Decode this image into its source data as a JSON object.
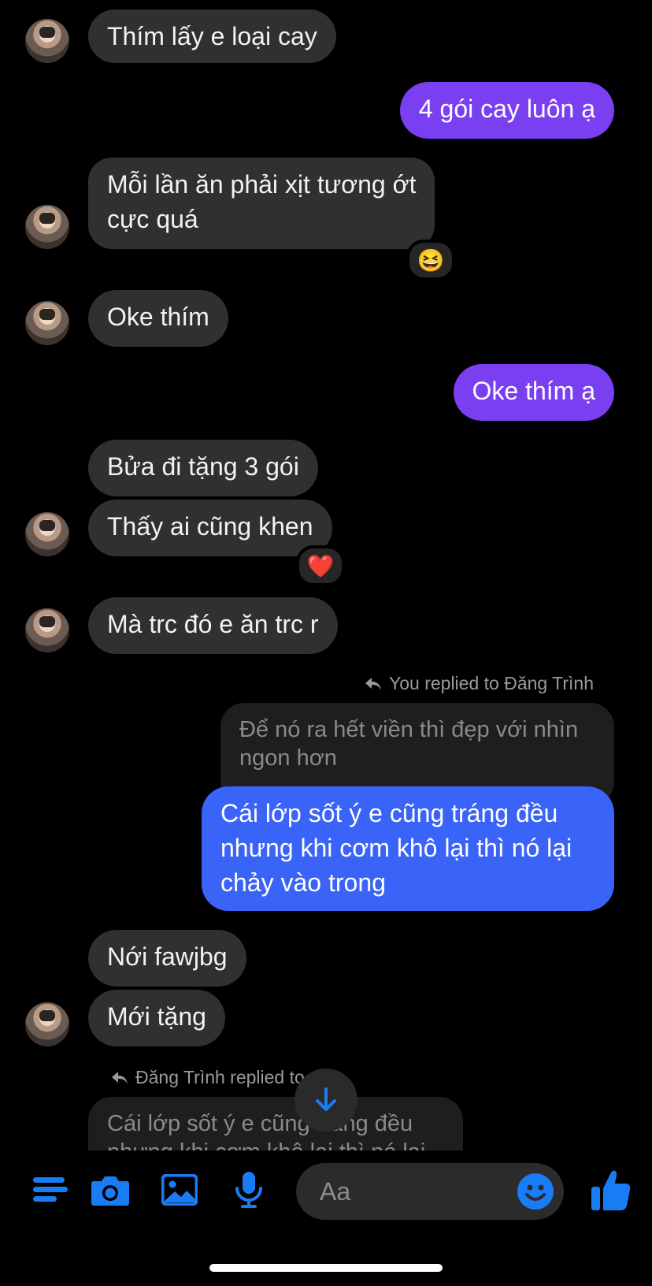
{
  "messages": {
    "m1": "Thím lấy e loại cay",
    "m2": "4 gói cay luôn ạ",
    "m3_l1": "Mỗi lần ăn phải xịt tương ớt",
    "m3_l2": "cực quá",
    "m3_reaction": "😆",
    "m4": "Oke thím",
    "m5": "Oke thím ạ",
    "m6": "Bửa đi tặng 3 gói",
    "m7": "Thấy ai cũng khen",
    "m7_reaction": "❤️",
    "m8": "Mà trc đó e ăn trc r",
    "reply1_note": "You replied to Đăng Trình",
    "reply1_quote_l1": "Để nó ra hết viền thì đẹp với nhìn",
    "reply1_quote_l2": "ngon hơn",
    "m9_l1": "Cái lớp sốt ý e cũng tráng đều",
    "m9_l2": "nhưng khi cơm khô lại thì nó lại",
    "m9_l3": "chảy vào trong",
    "m10": "Nới fawjbg",
    "m11": "Mới tặng",
    "reply2_note": "Đăng Trình replied to you",
    "reply2_quote_l1": "Cái lớp sốt ý e cũng tráng đều",
    "reply2_quote_l2": "nhưng khi cơm khô lại thì nó lại"
  },
  "composer": {
    "placeholder": "Aa"
  },
  "icons": {
    "menu": "menu-icon",
    "camera": "camera-icon",
    "gallery": "image-icon",
    "mic": "microphone-icon",
    "emoji": "emoji-icon",
    "like": "thumbs-up-icon",
    "scroll_down": "arrow-down-icon"
  },
  "colors": {
    "accent_blue": "#1a7cf5",
    "outgoing_purple": "#7b3ff2",
    "outgoing_blue": "#3a63f7",
    "incoming_gray": "#303030"
  }
}
